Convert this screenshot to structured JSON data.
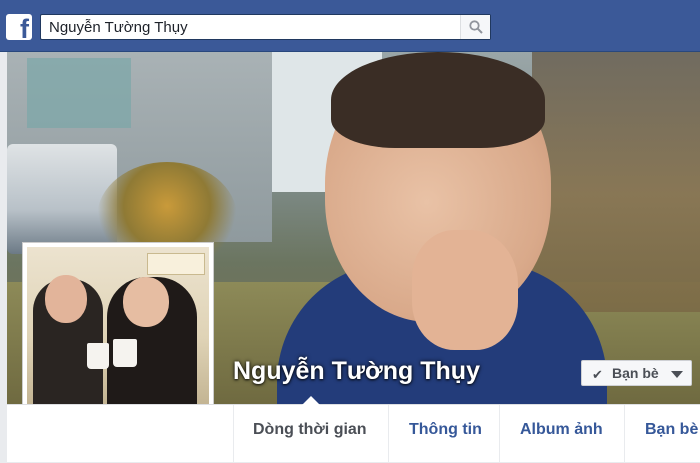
{
  "header": {
    "logo_letter": "f",
    "search": {
      "value": "Nguyễn Tường Thụy",
      "placeholder": ""
    }
  },
  "profile": {
    "name": "Nguyễn Tường Thụy",
    "friend_button": "Bạn bè"
  },
  "tabs": [
    {
      "label": "Dòng thời gian",
      "active": true
    },
    {
      "label": "Thông tin"
    },
    {
      "label": "Album ảnh"
    },
    {
      "label": "Bạn bè"
    }
  ],
  "colors": {
    "brand": "#3b5998",
    "link": "#365899",
    "text_dark": "#4b4f56"
  },
  "icons": {
    "logo": "facebook-logo-icon",
    "search": "search-icon",
    "check": "check-icon",
    "dropdown": "caret-down-icon"
  }
}
